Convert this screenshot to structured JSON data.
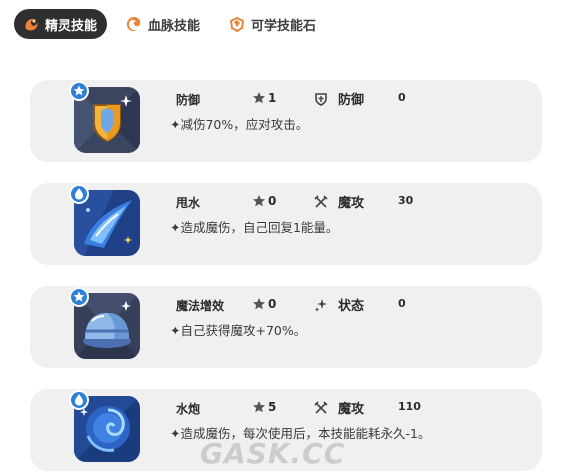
{
  "tabs": [
    {
      "label": "精灵技能",
      "icon": "spirit-swirl-icon",
      "active": true
    },
    {
      "label": "血脉技能",
      "icon": "bloodline-swirl-icon",
      "active": false
    },
    {
      "label": "可学技能石",
      "icon": "skill-stone-icon",
      "active": false
    }
  ],
  "skills": [
    {
      "name": "防御",
      "cost": "1",
      "type": "防御",
      "type_icon": "shield-icon",
      "power": "0",
      "desc": "✦减伤70%，应对攻击。",
      "badge": "star-badge-icon",
      "art": "golden-shield-icon"
    },
    {
      "name": "甩水",
      "cost": "0",
      "type": "魔攻",
      "type_icon": "crossed-wands-icon",
      "power": "30",
      "desc": "✦造成魔伤，自己回复1能量。",
      "badge": "water-drop-badge-icon",
      "art": "water-splash-icon"
    },
    {
      "name": "魔法增效",
      "cost": "0",
      "type": "状态",
      "type_icon": "sparkle-icon",
      "power": "0",
      "desc": "✦自己获得魔攻+70%。",
      "badge": "star-badge-icon",
      "art": "magic-dome-icon"
    },
    {
      "name": "水炮",
      "cost": "5",
      "type": "魔攻",
      "type_icon": "crossed-wands-icon",
      "power": "110",
      "desc": "✦造成魔伤，每次使用后，本技能能耗永久-1。",
      "badge": "water-drop-badge-icon",
      "art": "water-vortex-icon"
    }
  ],
  "watermark": "GASK.CC",
  "colors": {
    "active_tab_bg": "#2f2f2f",
    "card_bg": "#f0f0f0",
    "tab_icon_orange": "#e8843c",
    "badge_blue": "#2f7fd6"
  }
}
